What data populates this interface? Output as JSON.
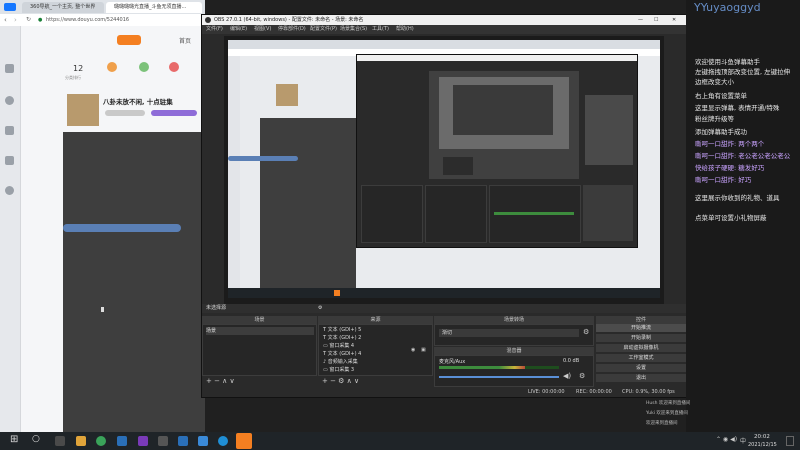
{
  "browser": {
    "tabs": [
      {
        "label": "360导航_一个主页, 整个世界",
        "active": false
      },
      {
        "label": "璐璐璐璐光直播_斗鱼无须直播...",
        "active": true
      }
    ],
    "url": "https://www.douyu.com/5244016",
    "header_right": "首页",
    "stats": {
      "count": "12",
      "count_label": "分类排行"
    },
    "room_title": "八卦未放不闲, 十点驻集"
  },
  "obs": {
    "window_title": "OBS 27.0.1 (64-bit, windows) - 配置文件: 未命名 - 场景: 未命名",
    "menu": [
      "文件(F)",
      "编辑(E)",
      "视图(V)",
      "停靠部件(D)",
      "配置文件(P)",
      "场景集合(S)",
      "工具(T)",
      "帮助(H)"
    ],
    "status_label": "未选择源",
    "scenes": {
      "title": "场景",
      "items": [
        "场景"
      ]
    },
    "sources": {
      "title": "来源",
      "items": [
        "文本 (GDI+) 5",
        "文本 (GDI+) 2",
        "窗口采集 4",
        "文本 (GDI+) 4",
        "音频输入采集",
        "窗口采集 3"
      ]
    },
    "transition": {
      "title": "场景转场",
      "value": "渐切"
    },
    "mixer": {
      "title": "混音器",
      "channel": "麦克风/Aux",
      "level": "0.0 dB",
      "fill": 0.72
    },
    "controls": {
      "title": "控件",
      "buttons": [
        "开始推流",
        "开始录制",
        "启动虚拟摄像机",
        "工作室模式",
        "设置",
        "退出"
      ],
      "active_index": 0
    },
    "statusbar": {
      "live": "LIVE: 00:00:00",
      "rec": "REC: 00:00:00",
      "cpu": "CPU: 0.9%, 30.00 fps"
    }
  },
  "chat": {
    "watermark": "YYuyaoggyd",
    "lines": [
      {
        "text": "欢迎使用斗鱼弹幕助手",
        "color": "#e8e8e8"
      },
      {
        "text": "左键拖拽顶部改变位置, 左键拉伸",
        "color": "#e8e8e8"
      },
      {
        "text": "边框改变大小",
        "color": "#e8e8e8"
      },
      {
        "text": "右上角有设置菜单",
        "color": "#e8e8e8"
      },
      {
        "text": "这里显示弹幕, 表情开通/特殊",
        "color": "#e8e8e8"
      },
      {
        "text": "粉丝牌升级等",
        "color": "#e8e8e8"
      },
      {
        "text": "添加弹幕助手成功",
        "color": "#e8e8e8"
      },
      {
        "text": "嘶呵一口甜炸: 两个两个",
        "color": "#c9a3ff"
      },
      {
        "text": "嘶呵一口甜炸: 老公老公老公老公",
        "color": "#c9a3ff"
      },
      {
        "text": "快给孩子硬硬: 糖发好巧",
        "color": "#c9a3ff"
      },
      {
        "text": "嘶呵一口甜炸: 好巧",
        "color": "#c9a3ff"
      },
      {
        "text": "这里展示你收到的礼物、道具",
        "color": "#e8e8e8"
      },
      {
        "text": "点菜单可设置小礼物屏蔽",
        "color": "#e8e8e8"
      }
    ],
    "gift_rows": [
      "Hush 欢迎来到直播间",
      "Yuki 欢迎来到直播间",
      "欢迎来到直播间"
    ]
  },
  "taskbar": {
    "time": "20:02",
    "date": "2021/12/15",
    "lang": "中"
  }
}
